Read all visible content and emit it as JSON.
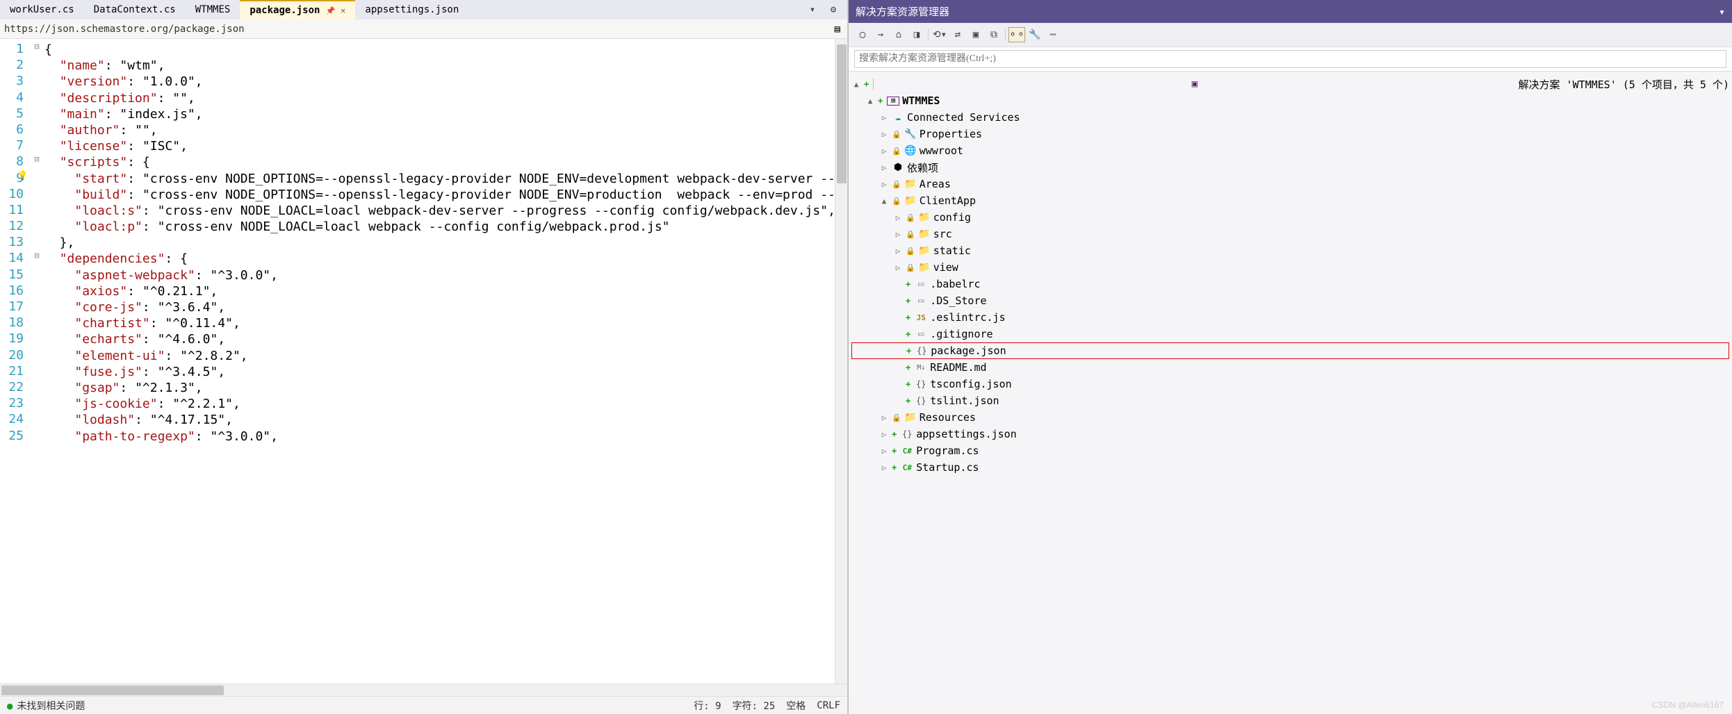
{
  "tabs": [
    {
      "label": "workUser.cs"
    },
    {
      "label": "DataContext.cs"
    },
    {
      "label": "WTMMES"
    },
    {
      "label": "package.json",
      "active": true
    },
    {
      "label": "appsettings.json"
    }
  ],
  "nav_url": "https://json.schemastore.org/package.json",
  "code_lines": [
    {
      "n": 1,
      "fold": "-",
      "txt": "{"
    },
    {
      "n": 2,
      "txt": "  \"name\": \"wtm\","
    },
    {
      "n": 3,
      "txt": "  \"version\": \"1.0.0\","
    },
    {
      "n": 4,
      "txt": "  \"description\": \"\","
    },
    {
      "n": 5,
      "txt": "  \"main\": \"index.js\","
    },
    {
      "n": 6,
      "txt": "  \"author\": \"\","
    },
    {
      "n": 7,
      "txt": "  \"license\": \"ISC\","
    },
    {
      "n": 8,
      "fold": "-",
      "txt": "  \"scripts\": {"
    },
    {
      "n": 9,
      "bulb": true,
      "txt": "    \"start\": \"cross-env NODE_OPTIONS=--openssl-legacy-provider NODE_ENV=development webpack-dev-server --mode development",
      "hl": "NODE_OPTIONS=--openssl-legacy-provider",
      "box": true
    },
    {
      "n": 10,
      "txt": "    \"build\": \"cross-env NODE_OPTIONS=--openssl-legacy-provider NODE_ENV=production  webpack --env=prod --progress  --conf",
      "box": true
    },
    {
      "n": 11,
      "txt": "    \"loacl:s\": \"cross-env NODE_LOACL=loacl webpack-dev-server --progress --config config/webpack.dev.js\","
    },
    {
      "n": 12,
      "txt": "    \"loacl:p\": \"cross-env NODE_LOACL=loacl webpack --config config/webpack.prod.js\""
    },
    {
      "n": 13,
      "txt": "  },"
    },
    {
      "n": 14,
      "fold": "-",
      "txt": "  \"dependencies\": {"
    },
    {
      "n": 15,
      "txt": "    \"aspnet-webpack\": \"^3.0.0\","
    },
    {
      "n": 16,
      "txt": "    \"axios\": \"^0.21.1\","
    },
    {
      "n": 17,
      "txt": "    \"core-js\": \"^3.6.4\","
    },
    {
      "n": 18,
      "txt": "    \"chartist\": \"^0.11.4\","
    },
    {
      "n": 19,
      "txt": "    \"echarts\": \"^4.6.0\","
    },
    {
      "n": 20,
      "txt": "    \"element-ui\": \"^2.8.2\","
    },
    {
      "n": 21,
      "txt": "    \"fuse.js\": \"^3.4.5\","
    },
    {
      "n": 22,
      "txt": "    \"gsap\": \"^2.1.3\","
    },
    {
      "n": 23,
      "txt": "    \"js-cookie\": \"^2.2.1\","
    },
    {
      "n": 24,
      "txt": "    \"lodash\": \"^4.17.15\","
    },
    {
      "n": 25,
      "txt": "    \"path-to-regexp\": \"^3.0.0\","
    }
  ],
  "status": {
    "issues": "未找到相关问题",
    "line": "行: 9",
    "col": "字符: 25",
    "spaces": "空格",
    "eol": "CRLF"
  },
  "sln": {
    "title": "解决方案资源管理器",
    "search_ph": "搜索解决方案资源管理器(Ctrl+;)",
    "root": "解决方案 'WTMMES' (5 个项目，共 5 个)",
    "project": "WTMMES",
    "nodes": [
      {
        "type": "cloud",
        "label": "Connected Services",
        "depth": 2,
        "tw": "▷"
      },
      {
        "type": "wrench",
        "label": "Properties",
        "depth": 2,
        "tw": "▷",
        "lock": true
      },
      {
        "type": "globe",
        "label": "wwwroot",
        "depth": 2,
        "tw": "▷",
        "lock": true
      },
      {
        "type": "pkg",
        "label": "依赖项",
        "depth": 2,
        "tw": "▷"
      },
      {
        "type": "fold",
        "label": "Areas",
        "depth": 2,
        "tw": "▷",
        "lock": true
      },
      {
        "type": "fold",
        "label": "ClientApp",
        "depth": 2,
        "tw": "▲",
        "lock": true
      },
      {
        "type": "fold",
        "label": "config",
        "depth": 3,
        "tw": "▷",
        "lock": true
      },
      {
        "type": "fold",
        "label": "src",
        "depth": 3,
        "tw": "▷",
        "lock": true
      },
      {
        "type": "fold",
        "label": "static",
        "depth": 3,
        "tw": "▷",
        "lock": true
      },
      {
        "type": "fold",
        "label": "view",
        "depth": 3,
        "tw": "▷",
        "lock": true
      },
      {
        "type": "file",
        "label": ".babelrc",
        "depth": 3,
        "plus": true
      },
      {
        "type": "file",
        "label": ".DS_Store",
        "depth": 3,
        "plus": true
      },
      {
        "type": "js",
        "label": ".eslintrc.js",
        "depth": 3,
        "plus": true
      },
      {
        "type": "file",
        "label": ".gitignore",
        "depth": 3,
        "plus": true
      },
      {
        "type": "json",
        "label": "package.json",
        "depth": 3,
        "plus": true,
        "redbox": true
      },
      {
        "type": "md",
        "label": "README.md",
        "depth": 3,
        "plus": true
      },
      {
        "type": "json",
        "label": "tsconfig.json",
        "depth": 3,
        "plus": true
      },
      {
        "type": "json",
        "label": "tslint.json",
        "depth": 3,
        "plus": true
      },
      {
        "type": "fold",
        "label": "Resources",
        "depth": 2,
        "tw": "▷",
        "lock": true
      },
      {
        "type": "json",
        "label": "appsettings.json",
        "depth": 2,
        "tw": "▷",
        "plus": true
      },
      {
        "type": "cs",
        "label": "Program.cs",
        "depth": 2,
        "tw": "▷",
        "plus": true
      },
      {
        "type": "cs",
        "label": "Startup.cs",
        "depth": 2,
        "tw": "▷",
        "plus": true
      }
    ]
  },
  "watermark": "CSDN @Allen6167"
}
